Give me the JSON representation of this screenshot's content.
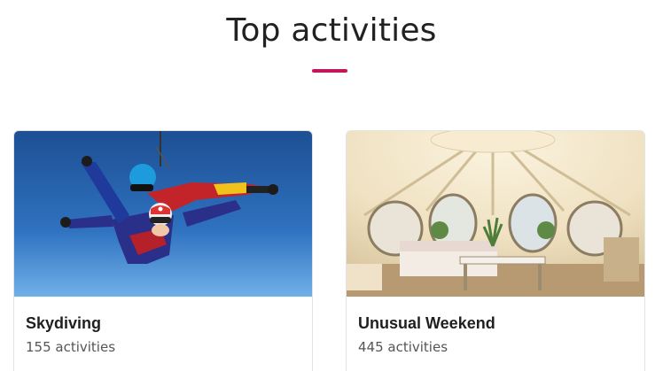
{
  "section": {
    "title": "Top activities",
    "accent_color": "#c2185b"
  },
  "cards": [
    {
      "title": "Skydiving",
      "count": "155 activities",
      "image": "tandem-skydivers-photo"
    },
    {
      "title": "Unusual Weekend",
      "count": "445 activities",
      "image": "glamping-tent-interior-photo"
    }
  ]
}
